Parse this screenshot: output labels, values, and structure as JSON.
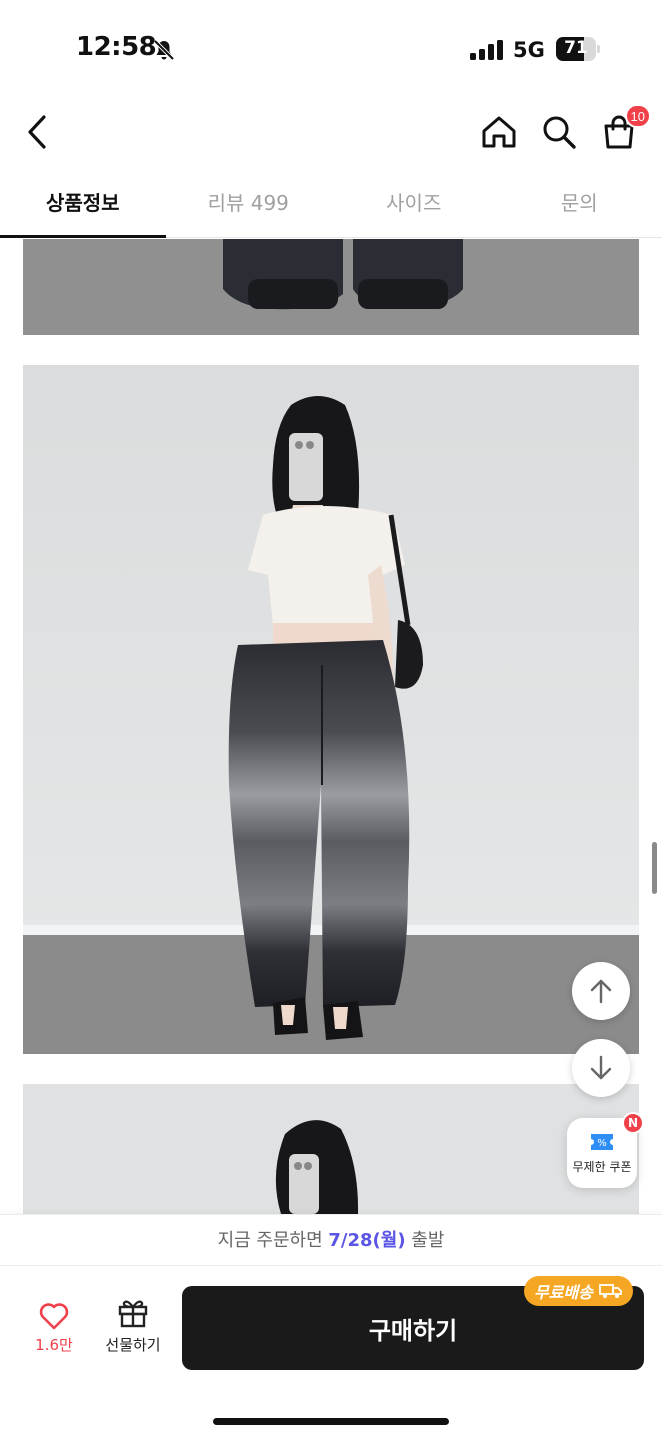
{
  "status_bar": {
    "time": "12:58",
    "network": "5G",
    "battery": "71",
    "battery_level": 0.71
  },
  "header": {
    "back_icon": "chevron-left-icon",
    "home_icon": "home-icon",
    "search_icon": "search-icon",
    "cart_icon": "shopping-bag-icon",
    "cart_count": "10"
  },
  "tabs": [
    {
      "label": "상품정보",
      "active": true
    },
    {
      "label": "리뷰 499",
      "active": false
    },
    {
      "label": "사이즈",
      "active": false
    },
    {
      "label": "문의",
      "active": false
    }
  ],
  "floating": {
    "up_icon": "arrow-up-icon",
    "down_icon": "arrow-down-icon",
    "coupon_label": "무제한 쿠폰",
    "coupon_badge": "N"
  },
  "ship_notice": {
    "prefix": "지금 주문하면",
    "date": "7/28(월)",
    "suffix": "출발"
  },
  "bottom_bar": {
    "like_count": "1.6만",
    "gift_label": "선물하기",
    "buy_label": "구매하기",
    "free_shipping": "무료배송"
  },
  "colors": {
    "accent_red": "#f0414b",
    "date_blue": "#5b55e6",
    "badge_orange": "#f5a623",
    "buy_button": "#1a1a1a"
  }
}
